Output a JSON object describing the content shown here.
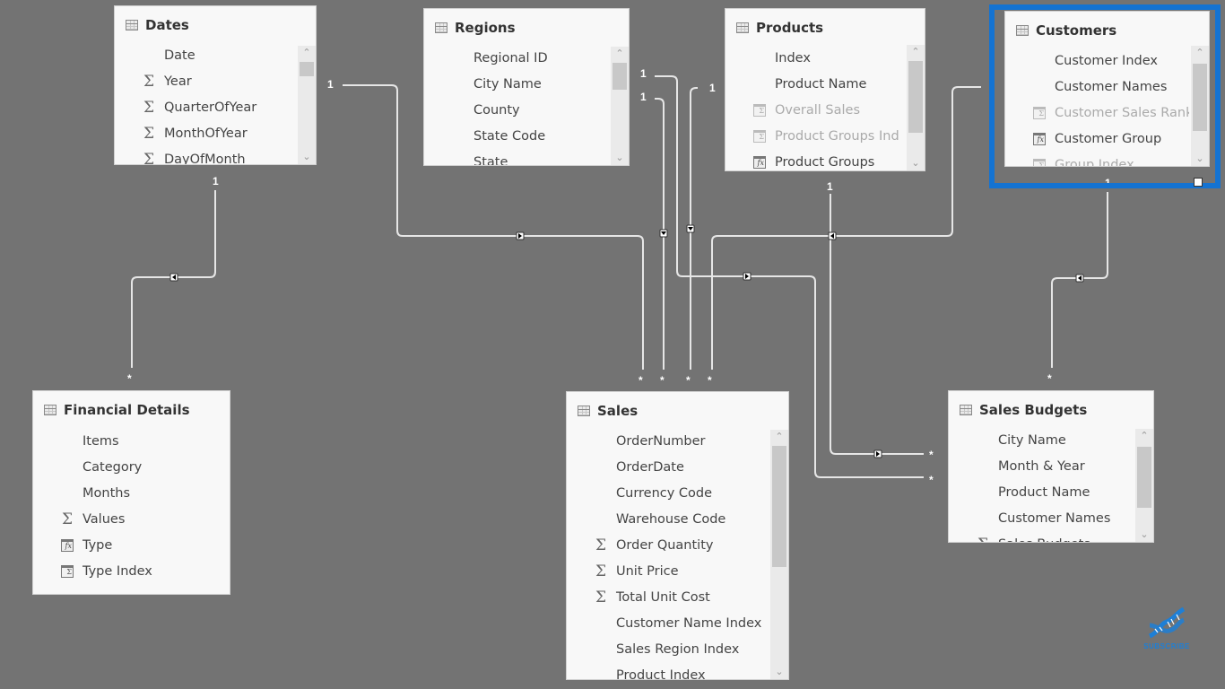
{
  "diagram": {
    "type": "data-model-relationships",
    "tables": [
      {
        "id": "dates",
        "name": "Dates",
        "fields": [
          {
            "name": "Date",
            "icon": "none"
          },
          {
            "name": "Year",
            "icon": "sigma"
          },
          {
            "name": "QuarterOfYear",
            "icon": "sigma"
          },
          {
            "name": "MonthOfYear",
            "icon": "sigma"
          },
          {
            "name": "DayOfMonth",
            "icon": "sigma"
          }
        ]
      },
      {
        "id": "regions",
        "name": "Regions",
        "fields": [
          {
            "name": "Regional ID",
            "icon": "none"
          },
          {
            "name": "City Name",
            "icon": "none"
          },
          {
            "name": "County",
            "icon": "none"
          },
          {
            "name": "State Code",
            "icon": "none"
          },
          {
            "name": "State",
            "icon": "none"
          }
        ]
      },
      {
        "id": "products",
        "name": "Products",
        "fields": [
          {
            "name": "Index",
            "icon": "none"
          },
          {
            "name": "Product Name",
            "icon": "none"
          },
          {
            "name": "Overall Sales",
            "icon": "measure",
            "hidden": true
          },
          {
            "name": "Product Groups Ind",
            "icon": "measure",
            "hidden": true
          },
          {
            "name": "Product Groups",
            "icon": "calculated-column"
          }
        ]
      },
      {
        "id": "customers",
        "name": "Customers",
        "selected": true,
        "fields": [
          {
            "name": "Customer Index",
            "icon": "none"
          },
          {
            "name": "Customer Names",
            "icon": "none"
          },
          {
            "name": "Customer Sales Rank",
            "icon": "measure",
            "hidden": true
          },
          {
            "name": "Customer Group",
            "icon": "calculated-column"
          },
          {
            "name": "Group Index",
            "icon": "measure",
            "hidden": true
          }
        ]
      },
      {
        "id": "financial",
        "name": "Financial Details",
        "fields": [
          {
            "name": "Items",
            "icon": "none"
          },
          {
            "name": "Category",
            "icon": "none"
          },
          {
            "name": "Months",
            "icon": "none"
          },
          {
            "name": "Values",
            "icon": "sigma"
          },
          {
            "name": "Type",
            "icon": "calculated-column"
          },
          {
            "name": "Type Index",
            "icon": "measure"
          }
        ]
      },
      {
        "id": "sales",
        "name": "Sales",
        "fields": [
          {
            "name": "OrderNumber",
            "icon": "none"
          },
          {
            "name": "OrderDate",
            "icon": "none"
          },
          {
            "name": "Currency Code",
            "icon": "none"
          },
          {
            "name": "Warehouse Code",
            "icon": "none"
          },
          {
            "name": "Order Quantity",
            "icon": "sigma"
          },
          {
            "name": "Unit Price",
            "icon": "sigma"
          },
          {
            "name": "Total Unit Cost",
            "icon": "sigma"
          },
          {
            "name": "Customer Name Index",
            "icon": "none"
          },
          {
            "name": "Sales Region Index",
            "icon": "none"
          },
          {
            "name": "Product Index",
            "icon": "none"
          }
        ]
      },
      {
        "id": "budgets",
        "name": "Sales Budgets",
        "fields": [
          {
            "name": "City Name",
            "icon": "none"
          },
          {
            "name": "Month & Year",
            "icon": "none"
          },
          {
            "name": "Product Name",
            "icon": "none"
          },
          {
            "name": "Customer Names",
            "icon": "none"
          },
          {
            "name": "Sales Budgets",
            "icon": "sigma"
          }
        ]
      }
    ],
    "relationships": [
      {
        "from": "dates",
        "to": "financial",
        "from_cardinality": "1",
        "to_cardinality": "*",
        "direction": "single"
      },
      {
        "from": "regions",
        "to": "sales",
        "from_cardinality": "1",
        "to_cardinality": "*",
        "direction": "single"
      },
      {
        "from": "dates",
        "to": "sales",
        "from_cardinality": "1",
        "to_cardinality": "*",
        "direction": "single"
      },
      {
        "from": "products",
        "to": "sales",
        "from_cardinality": "1",
        "to_cardinality": "*",
        "direction": "single"
      },
      {
        "from": "customers",
        "to": "sales",
        "from_cardinality": "1",
        "to_cardinality": "*",
        "direction": "single"
      },
      {
        "from": "regions",
        "to": "budgets",
        "from_cardinality": "1",
        "to_cardinality": "*",
        "direction": "single"
      },
      {
        "from": "products",
        "to": "budgets",
        "from_cardinality": "1",
        "to_cardinality": "*",
        "direction": "single"
      },
      {
        "from": "customers",
        "to": "budgets",
        "from_cardinality": "1",
        "to_cardinality": "*",
        "direction": "single"
      }
    ],
    "labels": {
      "one": "1",
      "many": "*"
    }
  },
  "scroll": {
    "up_glyph": "⌃",
    "down_glyph": "⌄"
  },
  "icons": {
    "sigma": "Σ",
    "calc_glyph": "fx",
    "measure_glyph": "Σ"
  },
  "branding": {
    "subscribe_label": "SUBSCRIBE",
    "accent": "#1e7fd6"
  },
  "selection": {
    "color": "#1473d2"
  }
}
